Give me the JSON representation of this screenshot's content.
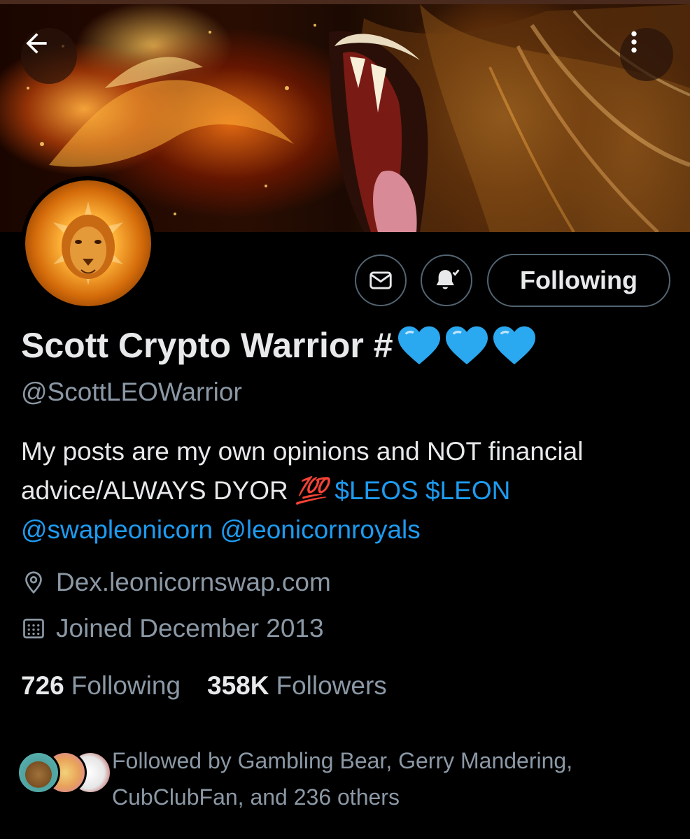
{
  "header": {
    "back_icon": "arrow-left-icon",
    "more_icon": "more-vertical-icon"
  },
  "actions": {
    "message_icon": "mail-icon",
    "notify_icon": "bell-check-icon",
    "follow_label": "Following"
  },
  "profile": {
    "display_name": "Scott Crypto Warrior #",
    "name_emoji": "blue-heart x3",
    "handle": "@ScottLEOWarrior",
    "bio": {
      "text_1": "My posts are my own opinions and NOT financial advice/ALWAYS DYOR",
      "emoji": "💯",
      "cashtags": "$LEOS $LEON",
      "mentions": "@swapleonicorn @leonicornroyals"
    },
    "website": "Dex.leonicornswap.com",
    "website_icon": "location-pin-icon",
    "joined": "Joined December 2013",
    "joined_icon": "calendar-icon"
  },
  "stats": {
    "following_count": "726",
    "following_label": "Following",
    "followers_count": "358K",
    "followers_label": "Followers"
  },
  "followed_by": {
    "text": "Followed by Gambling Bear, Gerry Mandering, CubClubFan, and 236 others"
  },
  "colors": {
    "background": "#000000",
    "text_primary": "#e7e9ea",
    "text_secondary": "#8b98a5",
    "link": "#1d9bf0",
    "border": "#536471",
    "heart": "#2aa8f0"
  }
}
